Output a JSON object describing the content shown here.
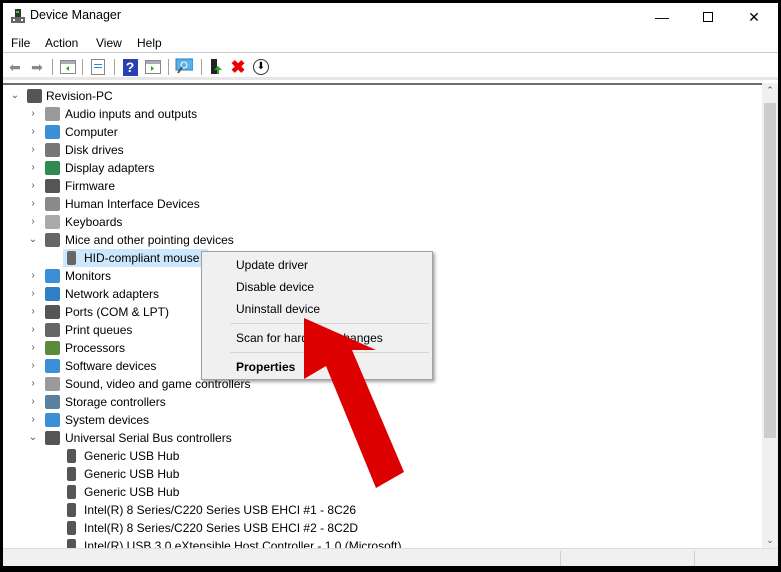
{
  "window": {
    "title": "Device Manager"
  },
  "menu": [
    "File",
    "Action",
    "View",
    "Help"
  ],
  "toolbar": {
    "icons": [
      "back-icon",
      "forward-icon",
      "show-hide-console-tree-icon",
      "properties-icon",
      "help-icon",
      "action-pane-icon",
      "scan-hardware-icon",
      "update-driver-icon",
      "uninstall-icon",
      "disable-icon"
    ]
  },
  "tree": {
    "root": "Revision-PC",
    "categories": [
      {
        "label": "Audio inputs and outputs",
        "icon": "speaker-icon",
        "color": "#9a9a9a"
      },
      {
        "label": "Computer",
        "icon": "monitor-icon",
        "color": "#3b8fd6"
      },
      {
        "label": "Disk drives",
        "icon": "disk-icon",
        "color": "#777777"
      },
      {
        "label": "Display adapters",
        "icon": "display-adapter-icon",
        "color": "#2f8a4f"
      },
      {
        "label": "Firmware",
        "icon": "chip-icon",
        "color": "#555555"
      },
      {
        "label": "Human Interface Devices",
        "icon": "hid-icon",
        "color": "#8a8a8a"
      },
      {
        "label": "Keyboards",
        "icon": "keyboard-icon",
        "color": "#aaaaaa"
      },
      {
        "label": "Mice and other pointing devices",
        "icon": "mouse-icon",
        "color": "#666666",
        "expanded": true,
        "children": [
          {
            "label": "HID-compliant mouse",
            "selected": true
          }
        ]
      },
      {
        "label": "Monitors",
        "icon": "monitor-icon",
        "color": "#3b8fd6"
      },
      {
        "label": "Network adapters",
        "icon": "network-icon",
        "color": "#2f7fc4"
      },
      {
        "label": "Ports (COM & LPT)",
        "icon": "port-icon",
        "color": "#555555"
      },
      {
        "label": "Print queues",
        "icon": "printer-icon",
        "color": "#666666"
      },
      {
        "label": "Processors",
        "icon": "cpu-icon",
        "color": "#5a8a3a"
      },
      {
        "label": "Software devices",
        "icon": "software-device-icon",
        "color": "#3b8fd6"
      },
      {
        "label": "Sound, video and game controllers",
        "icon": "speaker-icon",
        "color": "#9a9a9a"
      },
      {
        "label": "Storage controllers",
        "icon": "storage-icon",
        "color": "#5a7fa0"
      },
      {
        "label": "System devices",
        "icon": "system-icon",
        "color": "#3b8fd6"
      },
      {
        "label": "Universal Serial Bus controllers",
        "icon": "usb-icon",
        "color": "#555555",
        "expanded": true,
        "children": [
          {
            "label": "Generic USB Hub"
          },
          {
            "label": "Generic USB Hub"
          },
          {
            "label": "Generic USB Hub"
          },
          {
            "label": "Intel(R) 8 Series/C220 Series USB EHCI #1 - 8C26"
          },
          {
            "label": "Intel(R) 8 Series/C220 Series USB EHCI #2 - 8C2D"
          },
          {
            "label": "Intel(R) USB 3.0 eXtensible Host Controller - 1.0 (Microsoft)"
          }
        ]
      }
    ]
  },
  "context_menu": {
    "items": [
      "Update driver",
      "Disable device",
      "Uninstall device",
      "Scan for hardware changes",
      "Properties"
    ]
  },
  "colors": {
    "arrow": "#dd0000",
    "selection": "#cce8ff"
  }
}
